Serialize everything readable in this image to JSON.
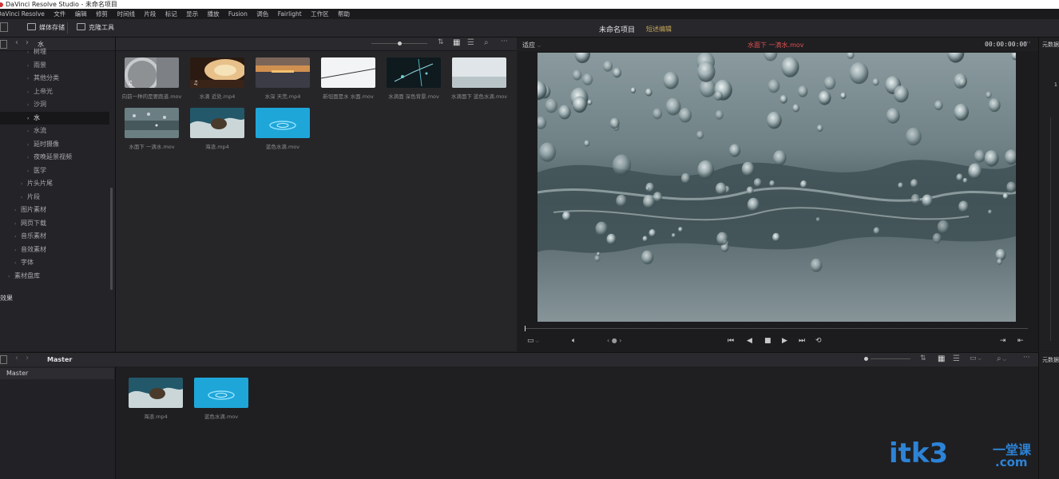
{
  "window": {
    "title": "DaVinci Resolve Studio - 未命名项目"
  },
  "menu": [
    "DaVinci Resolve",
    "文件",
    "编辑",
    "修剪",
    "时间线",
    "片段",
    "标记",
    "显示",
    "播放",
    "Fusion",
    "调色",
    "Fairlight",
    "工作区",
    "帮助"
  ],
  "toolbar": {
    "media_storage": "媒体存储",
    "clone_tool": "克隆工具"
  },
  "project": {
    "title": "未命名项目",
    "status": "短述编辑"
  },
  "bin_path": {
    "current": "水"
  },
  "bin_tree": [
    {
      "label": "树埋",
      "indent": 2,
      "selected": false
    },
    {
      "label": "雨景",
      "indent": 2,
      "selected": false
    },
    {
      "label": "其他分类",
      "indent": 2,
      "selected": false
    },
    {
      "label": "上帝光",
      "indent": 2,
      "selected": false
    },
    {
      "label": "沙洞",
      "indent": 2,
      "selected": false
    },
    {
      "label": "水",
      "indent": 2,
      "selected": true
    },
    {
      "label": "水流",
      "indent": 2,
      "selected": false
    },
    {
      "label": "延时摄像",
      "indent": 2,
      "selected": false
    },
    {
      "label": "夜晚延景视频",
      "indent": 2,
      "selected": false
    },
    {
      "label": "医学",
      "indent": 2,
      "selected": false
    },
    {
      "label": "片头片尾",
      "indent": 1,
      "selected": false
    },
    {
      "label": "片段",
      "indent": 1,
      "selected": false
    },
    {
      "label": "图片素材",
      "indent": 0,
      "selected": false
    },
    {
      "label": "网页下载",
      "indent": 0,
      "selected": false
    },
    {
      "label": "音乐素材",
      "indent": 0,
      "selected": false
    },
    {
      "label": "音效素材",
      "indent": 0,
      "selected": false
    },
    {
      "label": "字体",
      "indent": 0,
      "selected": false
    },
    {
      "label": "素材盘库",
      "indent": -1,
      "selected": false
    }
  ],
  "effects_label": "效果",
  "clips": [
    {
      "label": "向前一种的是要跑道.mov",
      "style": "gray"
    },
    {
      "label": "水滴 近处.mp4",
      "style": "sunset"
    },
    {
      "label": "水深 天荒.mp4",
      "style": "sea"
    },
    {
      "label": "新坦面是水 水面.mov",
      "style": "white"
    },
    {
      "label": "水滴面 深色背景.mov",
      "style": "dark"
    },
    {
      "label": "水滴面下 蓝色水滴.mov",
      "style": "light"
    },
    {
      "label": "水面下 一滴水.mov",
      "style": "gray2"
    },
    {
      "label": "海浪.mp4",
      "style": "wave"
    },
    {
      "label": "蓝色水滴.mov",
      "style": "blue"
    }
  ],
  "viewer": {
    "zoom": "适应",
    "clip_name": "水面下 一滴水.mov",
    "timecode": "00:00:00:00",
    "right_label": "元数据"
  },
  "lower": {
    "bin_title": "Master",
    "tree_item": "Master",
    "right_label": "元数据",
    "clips": [
      {
        "label": "海浪.mp4",
        "style": "wave"
      },
      {
        "label": "蓝色水滴.mov",
        "style": "blue"
      }
    ]
  },
  "watermark": {
    "text": "itk3",
    "sub": "一堂课",
    "sub2": ".com"
  },
  "colors": {
    "accent_red": "#e05050",
    "status_gold": "#c9a75a",
    "watermark_blue": "#2d83d6"
  }
}
